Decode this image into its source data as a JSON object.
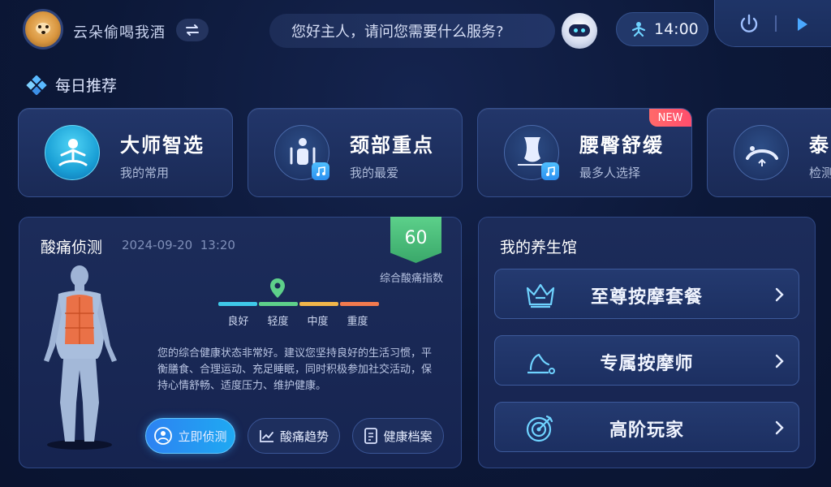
{
  "header": {
    "username": "云朵偷喝我酒",
    "greeting": "您好主人，请问您需要什么服务?",
    "time": "14:00",
    "icons": [
      "avatar",
      "switch-icon",
      "robot-icon",
      "person-icon",
      "power-icon",
      "play-icon"
    ]
  },
  "daily": {
    "title": "每日推荐",
    "cards": [
      {
        "title": "大师智选",
        "subtitle": "我的常用",
        "icon": "meditation-icon"
      },
      {
        "title": "颈部重点",
        "subtitle": "我的最爱",
        "icon": "neck-icon"
      },
      {
        "title": "腰臀舒缓",
        "subtitle": "最多人选择",
        "icon": "waist-icon",
        "tag": "NEW"
      },
      {
        "title": "泰",
        "subtitle": "检测",
        "icon": "stretch-icon"
      }
    ]
  },
  "soreness": {
    "title": "酸痛侦测",
    "date": "2024-09-20",
    "time": "13:20",
    "score": "60",
    "score_label": "综合酸痛指数",
    "levels": [
      "良好",
      "轻度",
      "中度",
      "重度"
    ],
    "level_colors": [
      "#3fc8e8",
      "#5ed08a",
      "#f1b64a",
      "#f27a4e"
    ],
    "current_level": "轻度",
    "description": "您的综合健康状态非常好。建议您坚持良好的生活习惯，平衡膳食、合理运动、充足睡眠，同时积极参加社交活动，保持心情舒畅、适度压力、维护健康。",
    "buttons": {
      "detect": "立即侦测",
      "trend": "酸痛趋势",
      "records": "健康档案"
    }
  },
  "wellness": {
    "title": "我的养生馆",
    "items": [
      {
        "label": "至尊按摩套餐",
        "icon": "crown-icon"
      },
      {
        "label": "专属按摩师",
        "icon": "massage-hand-icon"
      },
      {
        "label": "高阶玩家",
        "icon": "target-icon"
      }
    ]
  }
}
